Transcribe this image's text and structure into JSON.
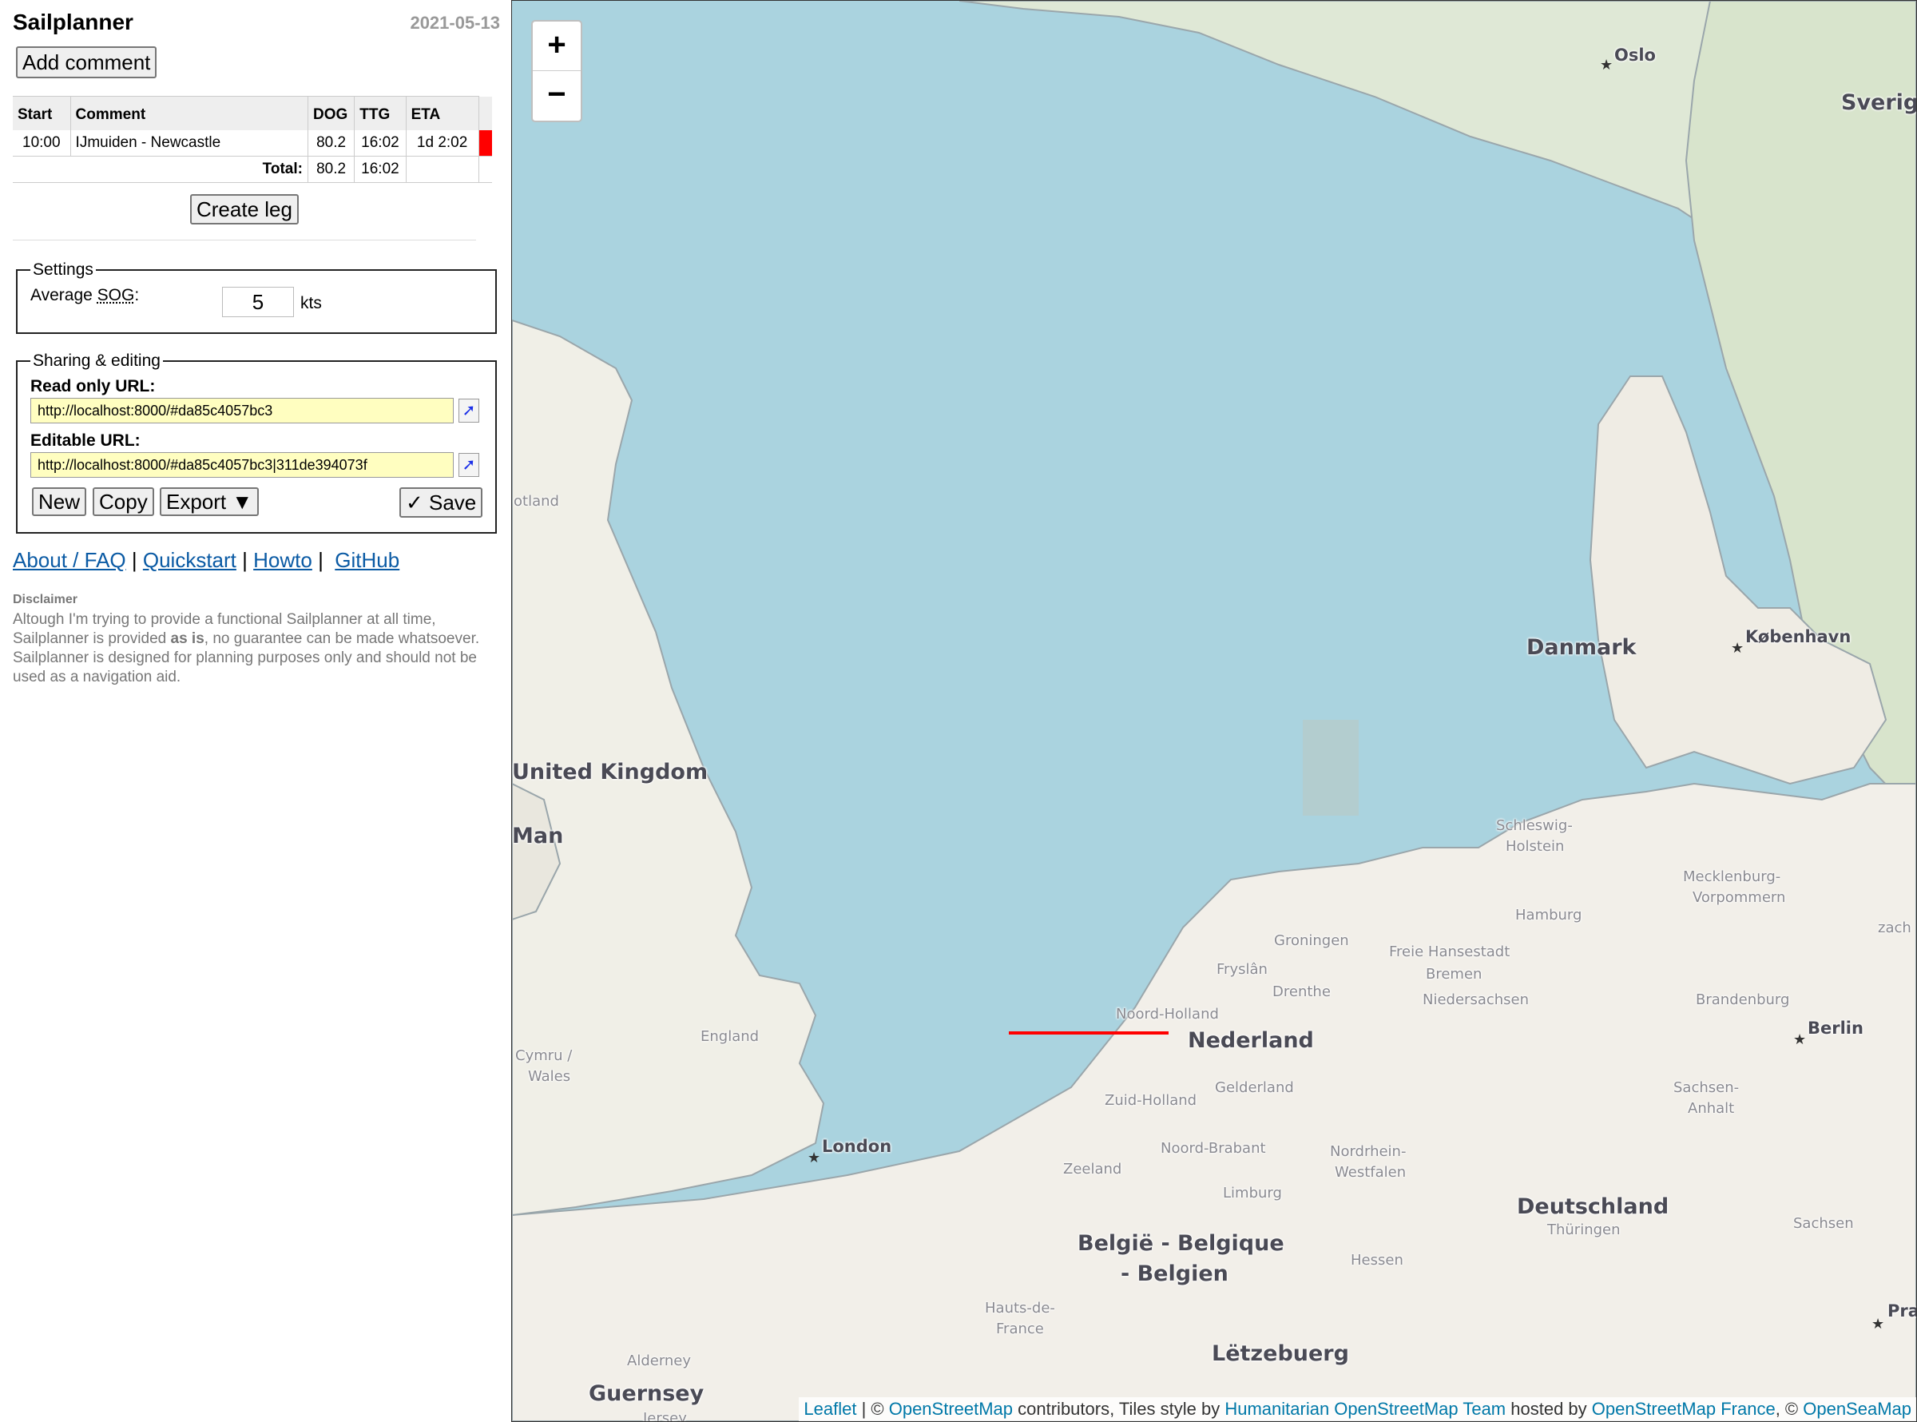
{
  "app": {
    "title": "Sailplanner",
    "date": "2021-05-13"
  },
  "buttons": {
    "add_comment": "Add comment",
    "create_leg": "Create leg",
    "new": "New",
    "copy": "Copy",
    "export": "Export ▼",
    "save": "✓ Save"
  },
  "legs_table": {
    "headers": [
      "Start",
      "Comment",
      "DOG",
      "TTG",
      "ETA"
    ],
    "rows": [
      {
        "start": "10:00",
        "comment": "IJmuiden - Newcastle",
        "dog": "80.2",
        "ttg": "16:02",
        "eta": "1d 2:02",
        "color": "#ff0000"
      }
    ],
    "total": {
      "label": "Total:",
      "dog": "80.2",
      "ttg": "16:02"
    }
  },
  "settings": {
    "legend": "Settings",
    "label_prefix": "Average ",
    "label_abbr": "SOG",
    "label_suffix": ":",
    "sog_value": "5",
    "unit": "kts"
  },
  "sharing": {
    "legend": "Sharing & editing",
    "readonly_label": "Read only URL:",
    "readonly_url": "http://localhost:8000/#da85c4057bc3",
    "editable_label": "Editable URL:",
    "editable_url": "http://localhost:8000/#da85c4057bc3|311de394073f",
    "open_icon": "➚"
  },
  "links": [
    {
      "label": "About / FAQ"
    },
    {
      "label": "Quickstart"
    },
    {
      "label": "Howto"
    },
    {
      "label": "GitHub"
    }
  ],
  "link_separator": "|",
  "disclaimer": {
    "title": "Disclaimer",
    "line1_a": "Altough I'm trying to provide a functional Sailplanner at all time, Sailplanner is provided ",
    "line1_b": "as is",
    "line1_c": ", no guarantee can be made whatsoever.",
    "line2": "Sailplanner is designed for planning purposes only and should not be used as a navigation aid."
  },
  "map": {
    "zoom_in": "+",
    "zoom_out": "−",
    "route_color": "#ff0000",
    "sea_color": "#aad3df",
    "land_color": "#f2efe9",
    "labels": {
      "oslo": "Oslo",
      "sverige": "Sverige",
      "kobenhavn": "København",
      "danmark": "Danmark",
      "united_kingdom": "United Kingdom",
      "man": "Man",
      "otland": "otland",
      "schleswig": "Schleswig-",
      "holstein": "Holstein",
      "mecklenburg": "Mecklenburg-",
      "vorpommern": "Vorpommern",
      "hamburg": "Hamburg",
      "groningen": "Groningen",
      "freie": "Freie Hansestadt",
      "bremen": "Bremen",
      "friesland": "Fryslân",
      "drenthe": "Drenthe",
      "niedersachsen": "Niedersachsen",
      "brandenburg": "Brandenburg",
      "berlin": "Berlin",
      "noord_holland": "Noord-Holland",
      "nederland": "Nederland",
      "gelderland": "Gelderland",
      "zuid_holland": "Zuid-Holland",
      "sachsen_anhalt": "Sachsen-",
      "anhalt": "Anhalt",
      "cymru": "Cymru /",
      "wales": "Wales",
      "england": "England",
      "london": "London",
      "noord_brabant": "Noord-Brabant",
      "nordrhein": "Nordrhein-",
      "westfalen": "Westfalen",
      "zeeland": "Zeeland",
      "limburg": "Limburg",
      "deutschland": "Deutschland",
      "thuringen": "Thüringen",
      "sachsen": "Sachsen",
      "belgie1": "België - Belgique",
      "belgie2": "- Belgien",
      "hessen": "Hessen",
      "hauts": "Hauts-de-",
      "france": "France",
      "letzebuerg": "Lëtzebuerg",
      "alderney": "Alderney",
      "guernsey": "Guernsey",
      "jersey": "Jersey",
      "praha": "Pra",
      "zach": "zach"
    },
    "attribution": {
      "leaflet": "Leaflet",
      "sep1": " | © ",
      "osm": "OpenStreetMap",
      "t1": " contributors, Tiles style by ",
      "hot": "Humanitarian OpenStreetMap Team",
      "t2": " hosted by ",
      "osmfr": "OpenStreetMap France",
      "t3": ", © ",
      "openseamap": "OpenSeaMap"
    }
  }
}
